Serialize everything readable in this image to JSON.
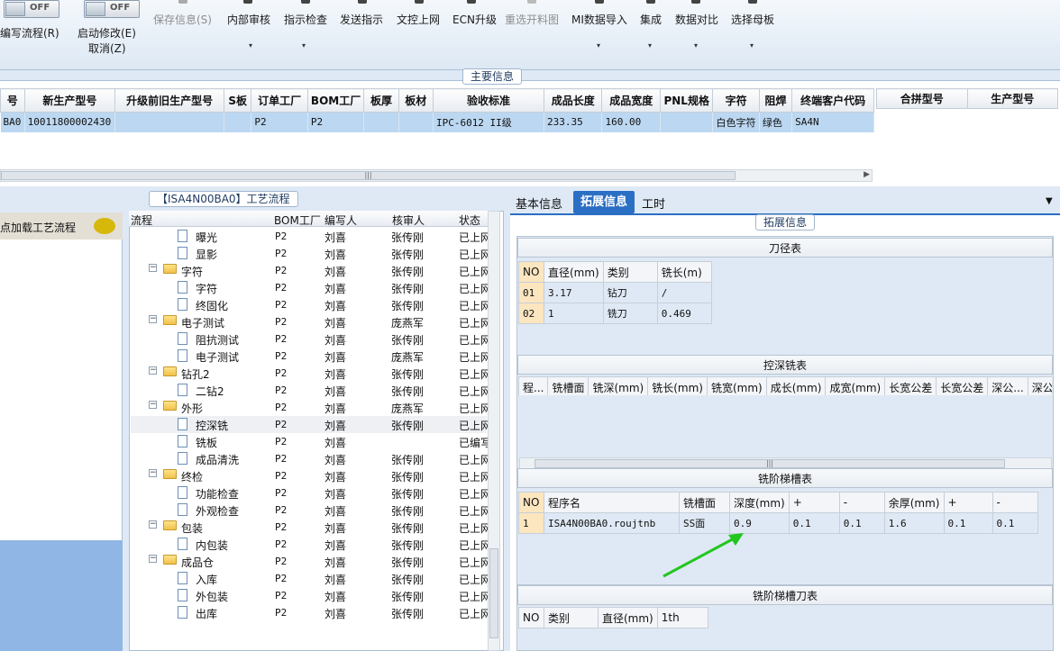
{
  "toolbar": {
    "toggle1": "OFF",
    "toggle2": "OFF",
    "edit_flow": "编写流程(R)",
    "start_modify": "启动修改(E)",
    "cancel": "取消(Z)",
    "save_info": "保存信息(S)",
    "internal_audit": "内部审核",
    "instruct_check": "指示检查",
    "send_instruct": "发送指示",
    "doc_upload": "文控上网",
    "ecn_upgrade": "ECN升级",
    "reselect_material": "重选开料图",
    "mi_import": "MI数据导入",
    "integrate": "集成",
    "data_compare": "数据对比",
    "select_master": "选择母板",
    "arrow": "▾"
  },
  "main_info": {
    "title": "主要信息",
    "columns": [
      "号",
      "新生产型号",
      "升级前旧生产型号",
      "S板",
      "订单工厂",
      "BOM工厂",
      "板厚",
      "板材",
      "验收标准",
      "成品长度",
      "成品宽度",
      "PNL规格",
      "字符",
      "阻焊",
      "终端客户代码"
    ],
    "row": [
      "BA0",
      "10011800002430",
      "",
      "",
      "P2",
      "P2",
      "",
      "",
      "IPC-6012 II级",
      "233.35",
      "160.00",
      "",
      "白色字符",
      "绿色",
      "SA4N"
    ],
    "scroll_mark": "|||"
  },
  "right_info": {
    "columns": [
      "合拼型号",
      "生产型号"
    ]
  },
  "left_panel": {
    "load_text": "点加载工艺流程"
  },
  "flow": {
    "title": "【ISA4N00BA0】工艺流程",
    "columns": [
      "流程",
      "BOM工厂",
      "编写人",
      "核审人",
      "状态"
    ],
    "rows": [
      {
        "name": "曝光",
        "level": 2,
        "factory": "P2",
        "author": "刘喜",
        "reviewer": "张传刚",
        "status": "已上网"
      },
      {
        "name": "显影",
        "level": 2,
        "factory": "P2",
        "author": "刘喜",
        "reviewer": "张传刚",
        "status": "已上网"
      },
      {
        "name": "字符",
        "level": 1,
        "factory": "P2",
        "author": "刘喜",
        "reviewer": "张传刚",
        "status": "已上网"
      },
      {
        "name": "字符",
        "level": 2,
        "factory": "P2",
        "author": "刘喜",
        "reviewer": "张传刚",
        "status": "已上网"
      },
      {
        "name": "终固化",
        "level": 2,
        "factory": "P2",
        "author": "刘喜",
        "reviewer": "张传刚",
        "status": "已上网"
      },
      {
        "name": "电子测试",
        "level": 1,
        "factory": "P2",
        "author": "刘喜",
        "reviewer": "庞燕军",
        "status": "已上网"
      },
      {
        "name": "阻抗测试",
        "level": 2,
        "factory": "P2",
        "author": "刘喜",
        "reviewer": "张传刚",
        "status": "已上网"
      },
      {
        "name": "电子测试",
        "level": 2,
        "factory": "P2",
        "author": "刘喜",
        "reviewer": "庞燕军",
        "status": "已上网"
      },
      {
        "name": "钻孔2",
        "level": 1,
        "factory": "P2",
        "author": "刘喜",
        "reviewer": "张传刚",
        "status": "已上网"
      },
      {
        "name": "二钻2",
        "level": 2,
        "factory": "P2",
        "author": "刘喜",
        "reviewer": "张传刚",
        "status": "已上网"
      },
      {
        "name": "外形",
        "level": 1,
        "factory": "P2",
        "author": "刘喜",
        "reviewer": "庞燕军",
        "status": "已上网"
      },
      {
        "name": "控深铣",
        "level": 2,
        "factory": "P2",
        "author": "刘喜",
        "reviewer": "张传刚",
        "status": "已上网"
      },
      {
        "name": "铣板",
        "level": 2,
        "factory": "P2",
        "author": "刘喜",
        "reviewer": "",
        "status": "已编写"
      },
      {
        "name": "成品清洗",
        "level": 2,
        "factory": "P2",
        "author": "刘喜",
        "reviewer": "张传刚",
        "status": "已上网"
      },
      {
        "name": "终检",
        "level": 1,
        "factory": "P2",
        "author": "刘喜",
        "reviewer": "张传刚",
        "status": "已上网"
      },
      {
        "name": "功能检查",
        "level": 2,
        "factory": "P2",
        "author": "刘喜",
        "reviewer": "张传刚",
        "status": "已上网"
      },
      {
        "name": "外观检查",
        "level": 2,
        "factory": "P2",
        "author": "刘喜",
        "reviewer": "张传刚",
        "status": "已上网"
      },
      {
        "name": "包装",
        "level": 1,
        "factory": "P2",
        "author": "刘喜",
        "reviewer": "张传刚",
        "status": "已上网"
      },
      {
        "name": "内包装",
        "level": 2,
        "factory": "P2",
        "author": "刘喜",
        "reviewer": "张传刚",
        "status": "已上网"
      },
      {
        "name": "成品仓",
        "level": 1,
        "factory": "P2",
        "author": "刘喜",
        "reviewer": "张传刚",
        "status": "已上网"
      },
      {
        "name": "入库",
        "level": 2,
        "factory": "P2",
        "author": "刘喜",
        "reviewer": "张传刚",
        "status": "已上网"
      },
      {
        "name": "外包装",
        "level": 2,
        "factory": "P2",
        "author": "刘喜",
        "reviewer": "张传刚",
        "status": "已上网"
      },
      {
        "name": "出库",
        "level": 2,
        "factory": "P2",
        "author": "刘喜",
        "reviewer": "张传刚",
        "status": "已上网"
      }
    ]
  },
  "tabs": {
    "basic": "基本信息",
    "extended": "拓展信息",
    "hours": "工时",
    "dropdown": "▼"
  },
  "extended": {
    "title": "拓展信息",
    "knife_table": {
      "title": "刀径表",
      "columns": [
        "NO",
        "直径(mm)",
        "类别",
        "铣长(m)"
      ],
      "rows": [
        [
          "01",
          "3.17",
          "钻刀",
          "/"
        ],
        [
          "02",
          "1",
          "铣刀",
          "0.469"
        ]
      ]
    },
    "depth_table": {
      "title": "控深铣表",
      "columns": [
        "程...",
        "铣槽面",
        "铣深(mm)",
        "铣长(mm)",
        "铣宽(mm)",
        "成长(mm)",
        "成宽(mm)",
        "长宽公差",
        "长宽公差",
        "深公...",
        "深公"
      ],
      "scroll_mark": "|||"
    },
    "step_table": {
      "title": "铣阶梯槽表",
      "columns": [
        "NO",
        "程序名",
        "铣槽面",
        "深度(mm)",
        "+",
        "-",
        "余厚(mm)",
        "+",
        "-"
      ],
      "rows": [
        [
          "1",
          "ISA4N00BA0.roujtnb",
          "SS面",
          "0.9",
          "0.1",
          "0.1",
          "1.6",
          "0.1",
          "0.1"
        ]
      ]
    },
    "step_knife_table": {
      "title": "铣阶梯槽刀表",
      "columns": [
        "NO",
        "类别",
        "直径(mm)",
        "1th"
      ]
    }
  },
  "colors": {
    "selected_row": "#bcd7f1",
    "accent": "#2b6fc4",
    "arrow": "#22c61e"
  }
}
